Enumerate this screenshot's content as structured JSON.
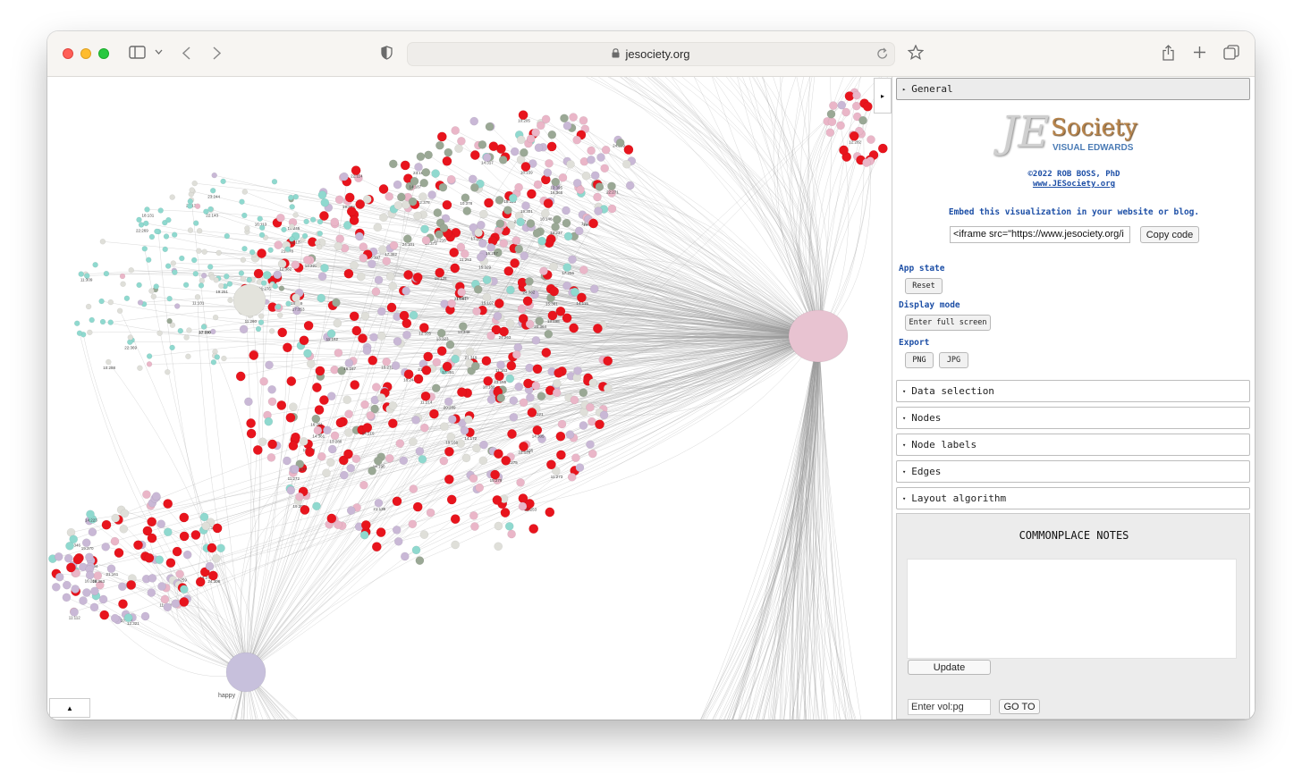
{
  "browser": {
    "url": "jesociety.org",
    "icons": [
      "sidebar-icon",
      "chevron-down-icon",
      "back-icon",
      "forward-icon",
      "shield-icon",
      "lock-icon",
      "reload-icon",
      "star-icon",
      "share-icon",
      "plus-icon",
      "tabs-icon"
    ]
  },
  "graph": {
    "hubs": [
      {
        "label": "happy",
        "color": "#c7c0dc"
      },
      {
        "label": "",
        "color": "#e8c3d1"
      },
      {
        "label": "",
        "color": "#e3e3dc"
      }
    ],
    "node_colors": [
      "#e8141d",
      "#c9b8d6",
      "#eab6c8",
      "#8fd9cf",
      "#9aa895",
      "#dfdfd9"
    ],
    "toggle_right": "▸",
    "toggle_bottom": "▲"
  },
  "panel": {
    "general": {
      "arrow": "▸",
      "label": "General"
    },
    "logo": {
      "js": "JE",
      "society": "Society",
      "subtitle": "VISUAL EDWARDS"
    },
    "copyright": "©2022 ROB BOSS, PhD",
    "site_link": "www.JESociety.org",
    "embed_text": "Embed this visualization in your website or blog.",
    "embed_code": "<iframe src=\"https://www.jesociety.org/i",
    "copy_code": "Copy code",
    "app_state_label": "App state",
    "reset": "Reset",
    "display_mode_label": "Display mode",
    "full_screen": "Enter full screen",
    "export_label": "Export",
    "png": "PNG",
    "jpg": "JPG",
    "sections": [
      {
        "arrow": "▾",
        "label": "Data selection"
      },
      {
        "arrow": "▾",
        "label": "Nodes"
      },
      {
        "arrow": "▾",
        "label": "Node labels"
      },
      {
        "arrow": "▾",
        "label": "Edges"
      },
      {
        "arrow": "▾",
        "label": "Layout algorithm"
      }
    ],
    "notes": {
      "title": "COMMONPLACE NOTES",
      "update": "Update",
      "goto_placeholder": "Enter vol:pg",
      "goto": "GO TO"
    }
  }
}
